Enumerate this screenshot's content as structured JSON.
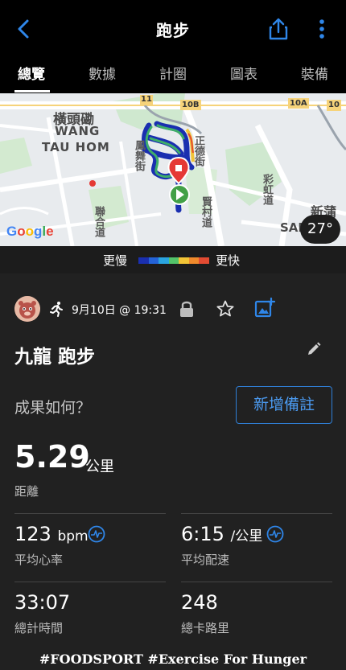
{
  "header": {
    "title": "跑步",
    "back_icon": "chevron-left-icon",
    "share_icon": "share-icon",
    "more_icon": "more-vertical-icon",
    "accent_color": "#2f86e8"
  },
  "tabs": [
    {
      "label": "總覽",
      "active": true
    },
    {
      "label": "數據",
      "active": false
    },
    {
      "label": "計圈",
      "active": false
    },
    {
      "label": "圖表",
      "active": false
    },
    {
      "label": "裝備",
      "active": false
    }
  ],
  "map": {
    "labels": {
      "area_cn": "橫頭磡",
      "area_en1": "WANG",
      "area_en2": "TAU HOM",
      "street1": "鳳舞街",
      "street2": "正德街",
      "street3": "聯合道",
      "street4": "賢村道",
      "street5": "彩虹道",
      "area2_cn": "新蒲崗",
      "area2_en": "SAN PO",
      "route_10b": "10B",
      "route_10a": "10A",
      "route_11": "11",
      "route_10": "10"
    },
    "google_logo": "Google",
    "temperature": "27°"
  },
  "legend": {
    "slower": "更慢",
    "faster": "更快",
    "colors": [
      "#1a2fb0",
      "#2463d8",
      "#2aa4e0",
      "#53c46a",
      "#f2c436",
      "#f08a2c",
      "#e24b32"
    ]
  },
  "activity": {
    "date": "9月10日 @ 19:31",
    "name": "九龍 跑步",
    "feel_prompt": "成果如何？",
    "add_note": "新增備註",
    "distance_value": "5.29",
    "distance_unit": "公里",
    "distance_label": "距離",
    "hr_value": "123",
    "hr_unit": "bpm",
    "hr_label": "平均心率",
    "pace_value": "6:15",
    "pace_unit": "/公里",
    "pace_label": "平均配速",
    "time_value": "33:07",
    "time_label": "總計時間",
    "calories_value": "248",
    "calories_label": "總卡路里"
  },
  "footer": {
    "caption": "#FOODSPORT #Exercise For Hunger"
  }
}
